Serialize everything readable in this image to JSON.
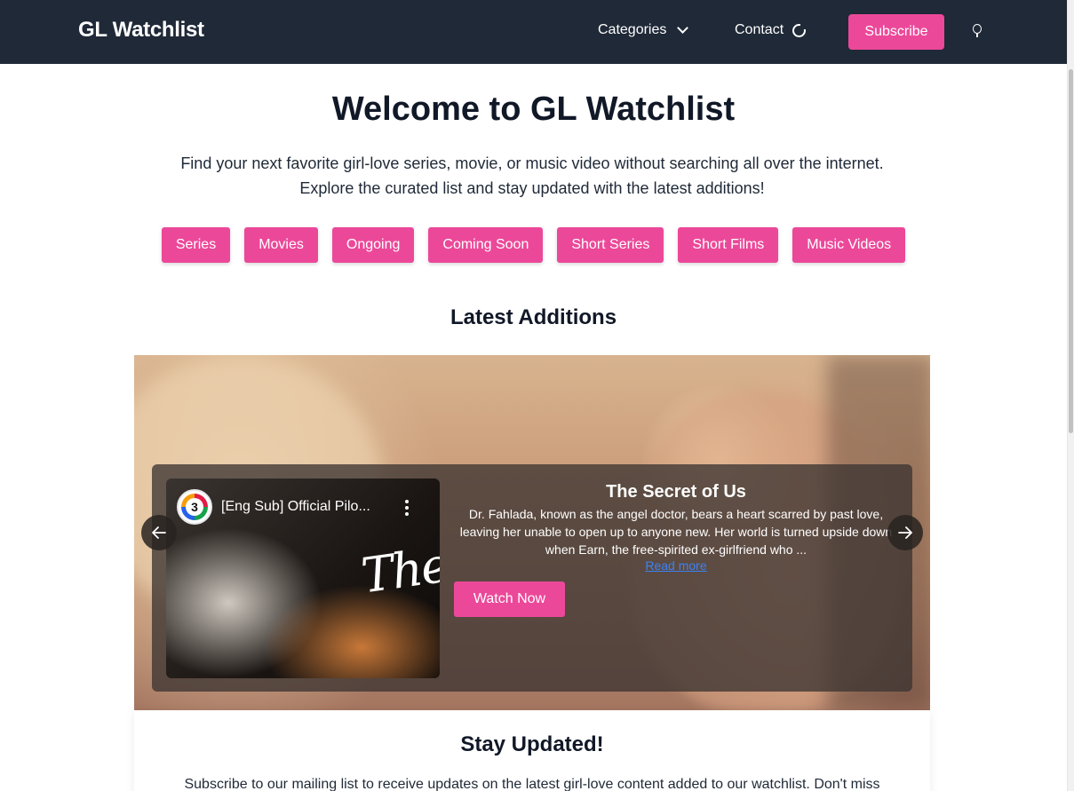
{
  "navbar": {
    "brand": "GL Watchlist",
    "categories_label": "Categories",
    "contact_label": "Contact",
    "subscribe_label": "Subscribe"
  },
  "hero": {
    "title": "Welcome to GL Watchlist",
    "text_line1": "Find your next favorite girl-love series, movie, or music video without searching all over the internet.",
    "text_line2": "Explore the curated list and stay updated with the latest additions!"
  },
  "categories": [
    "Series",
    "Movies",
    "Ongoing",
    "Coming Soon",
    "Short Series",
    "Short Films",
    "Music Videos"
  ],
  "latest": {
    "title": "Latest Additions",
    "slide": {
      "video_title": "[Eng Sub] Official Pilo...",
      "channel_glyph": "3",
      "video_overlay_text": "The",
      "title": "The Secret of Us",
      "description": "Dr. Fahlada, known as the angel doctor, bears a heart scarred by past love, leaving her unable to open up to anyone new. Her world is turned upside down when Earn, the free-spirited ex-girlfriend who ...",
      "read_more": "Read more",
      "watch_label": "Watch Now"
    }
  },
  "newsletter": {
    "title": "Stay Updated!",
    "text": "Subscribe to our mailing list to receive updates on the latest girl-love content added to our watchlist. Don't miss"
  },
  "colors": {
    "navbar": "#1f2937",
    "accent": "#ec4899",
    "link": "#3b82f6"
  }
}
